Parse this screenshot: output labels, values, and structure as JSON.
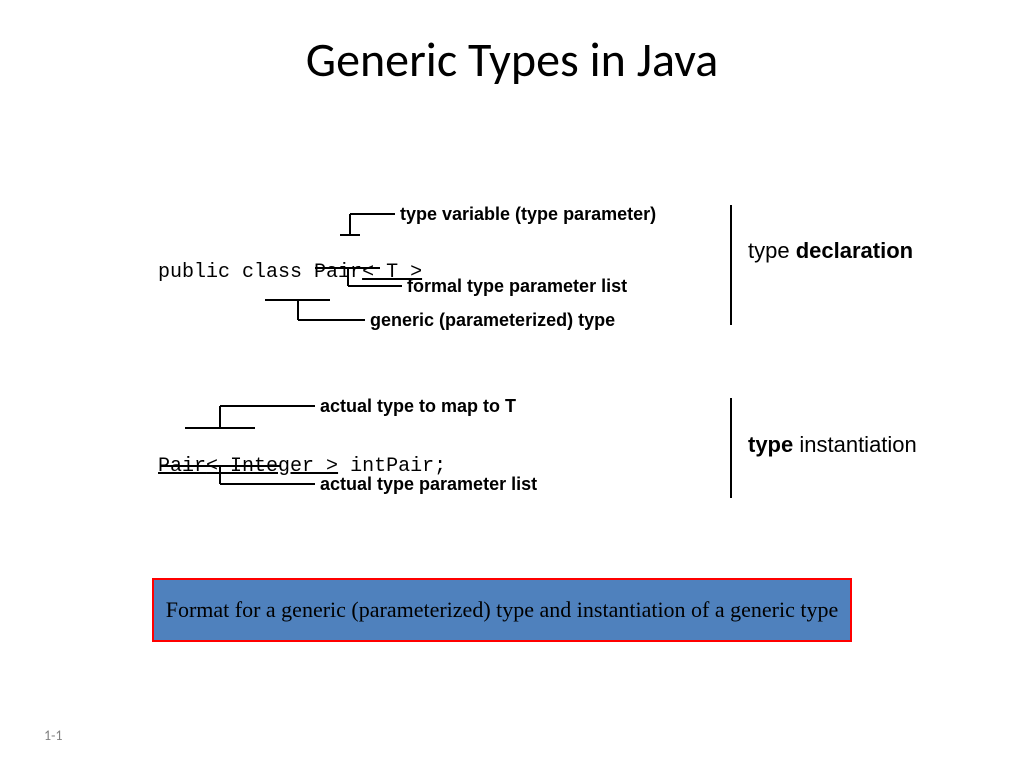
{
  "title": "Generic Types in Java",
  "decl": {
    "code_prefix": "public class Pair",
    "code_param": "< T >",
    "ann_type_variable": "type variable (type parameter)",
    "ann_formal_list": "formal type parameter list",
    "ann_generic_type": "generic (parameterized) type",
    "side_label_plain": "type ",
    "side_label_bold": "declaration"
  },
  "inst": {
    "code_prefix": "Pair",
    "code_param": "< Integer >",
    "code_suffix": " intPair;",
    "ann_actual_type": "actual type to map to T",
    "ann_actual_list": "actual type parameter list",
    "side_label_bold": "type ",
    "side_label_plain": "instantiation"
  },
  "caption": "Format for a generic (parameterized) type and instantiation of a generic type",
  "page_number": "1-1"
}
